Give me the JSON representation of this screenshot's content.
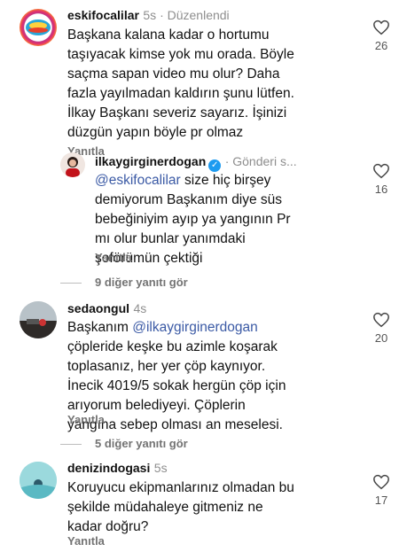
{
  "comments": [
    {
      "username": "eskifocalilar",
      "meta": "5s · Düzenlendi",
      "text": "Başkana kalana kadar o hortumu\ntaşıyacak kimse yok mu orada. Böyle\nsaçma sapan video mu olur? Daha\nfazla yayılmadan kaldırın şunu lütfen.\nİlkay Başkanı severiz sayarız. İşinizi\ndüzgün yapın böyle pr olmaz",
      "reply_label": "Yanıtla",
      "likes": "26"
    },
    {
      "username": "ilkaygirginerdogan",
      "verified_icon": "✓",
      "meta": "· Gönderi s...",
      "mention": "@eskifocalilar",
      "text": " size hiç birşey\ndemiyorum Başkanım diye süs\nbebeğiniyim ayıp ya yangının Pr\nmı olur bunlar yanımdaki\nşoförümün çektiği",
      "reply_label": "Yanıtla",
      "likes": "16"
    },
    {
      "username": "sedaongul",
      "meta": "4s",
      "prefix": "Başkanım ",
      "mention": "@ilkaygirginerdogan",
      "text": "\nçöpleride keşke bu azimle koşarak\ntoplasanız, her yer çöp kaynıyor.\nİnecik 4019/5 sokak hergün çöp için\narıyorum belediyeyi. Çöplerin\nyangına sebep olması an meselesi.",
      "reply_label": "Yanıtla",
      "likes": "20"
    },
    {
      "username": "denizindogasi",
      "meta": "5s",
      "text": "Koruyucu ekipmanlarınız olmadan bu\nşekilde müdahaleye gitmeniz ne\nkadar doğru?",
      "reply_label": "Yanıtla",
      "likes": "17"
    }
  ],
  "view_replies_1": "9 diğer yanıtı gör",
  "view_replies_2": "5 diğer yanıtı gör"
}
